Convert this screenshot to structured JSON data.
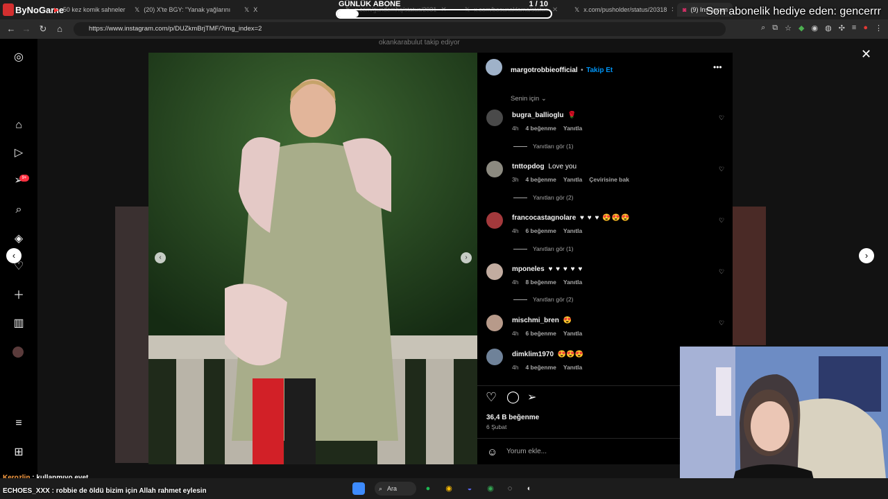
{
  "browser": {
    "tabs": [
      {
        "label": "50 kez komik sahneler",
        "icon": "youtube-icon"
      },
      {
        "label": "(20) X'te BGY: \"Yanak yağlarını",
        "icon": "x-icon"
      },
      {
        "label": "X",
        "icon": "x-icon"
      },
      {
        "label": "x.com/gundemhq/status/2031",
        "icon": "x-icon"
      },
      {
        "label": "x.com/bosunaklama/status",
        "icon": "x-icon"
      },
      {
        "label": "x.com/pusholder/status/20318",
        "icon": "x-icon"
      },
      {
        "label": "(9) Instagram",
        "icon": "instagram-icon"
      }
    ],
    "url": "https://www.instagram.com/p/DUZkmBrjTMF/?img_index=2"
  },
  "stream": {
    "logo": "ByNoGame",
    "sub_goal_title": "GÜNLÜK ABONE",
    "sub_goal_count": "1 / 10",
    "sub_goal_progress": 0.1,
    "gift_text": "Son abonelik hediye eden: gencerrr",
    "chat": [
      {
        "user": "Kerozlin",
        "message": ": kullanmıyo evet"
      },
      {
        "user": "ECHOES_XXX",
        "message": ": robbie de öldü bizim için Allah rahmet eylesin"
      }
    ]
  },
  "instagram": {
    "behind_text": "okankarabulut takip ediyor",
    "post": {
      "username": "margotrobbieofficial",
      "separator": "•",
      "follow_label": "Takip Et",
      "sort_label": "Senin için",
      "likes": "36,4 B beğenme",
      "date": "6 Şubat",
      "comment_placeholder": "Yorum ekle..."
    },
    "comments": [
      {
        "user": "bugra_ballioglu",
        "text": "🌹",
        "time": "4h",
        "likes": "4 beğenme",
        "reply": "Yanıtla",
        "translate": "",
        "replies": "Yanıtları gör (1)"
      },
      {
        "user": "tnttopdog",
        "text": "Love you",
        "time": "3h",
        "likes": "4 beğenme",
        "reply": "Yanıtla",
        "translate": "Çevirisine bak",
        "replies": "Yanıtları gör (2)"
      },
      {
        "user": "francocastagnolare",
        "text": "♥ ♥ ♥ 😍😍😍",
        "time": "4h",
        "likes": "6 beğenme",
        "reply": "Yanıtla",
        "translate": "",
        "replies": "Yanıtları gör (1)"
      },
      {
        "user": "mponeles",
        "text": "♥ ♥ ♥ ♥ ♥",
        "time": "4h",
        "likes": "8 beğenme",
        "reply": "Yanıtla",
        "translate": "",
        "replies": "Yanıtları gör (2)"
      },
      {
        "user": "mischmi_bren",
        "text": "😍",
        "time": "4h",
        "likes": "6 beğenme",
        "reply": "Yanıtla",
        "translate": "",
        "replies": ""
      },
      {
        "user": "dimklim1970",
        "text": "😍😍😍",
        "time": "4h",
        "likes": "4 beğenme",
        "reply": "Yanıtla",
        "translate": "",
        "replies": ""
      }
    ]
  },
  "taskbar": {
    "search_label": "Ara"
  }
}
